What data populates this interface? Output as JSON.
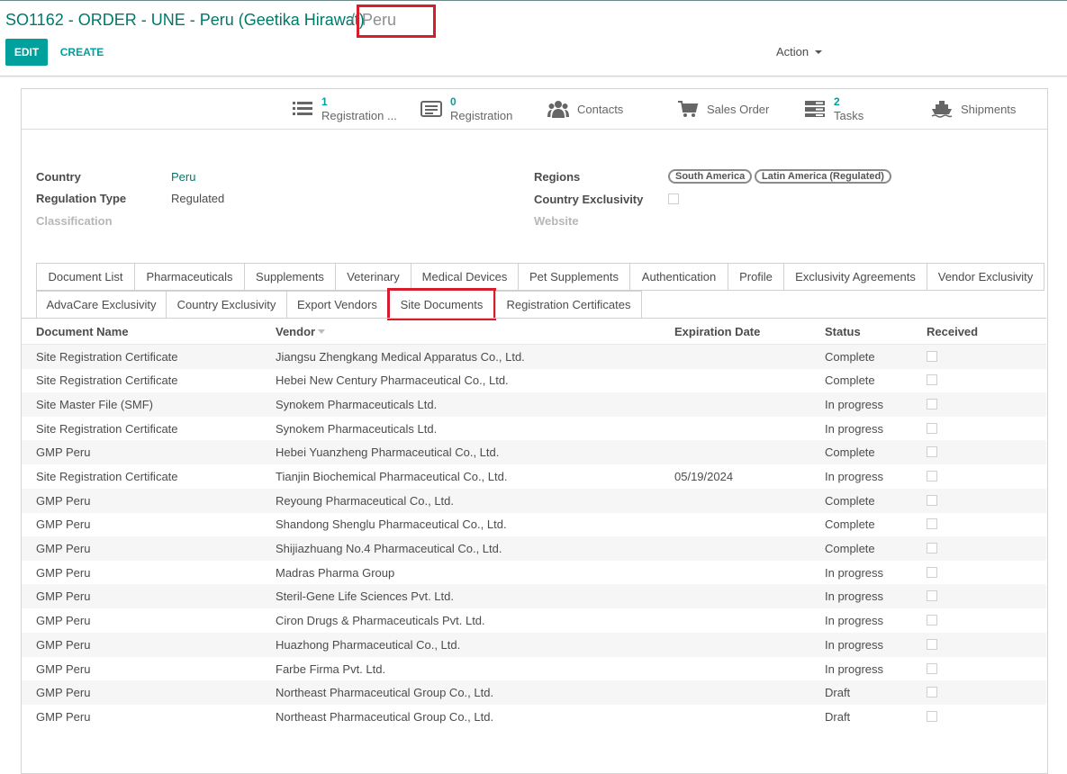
{
  "breadcrumb": {
    "parent": "SO1162 - ORDER - UNE - Peru (Geetika Hirawat)",
    "separator": "/",
    "current": "Peru"
  },
  "toolbar": {
    "edit_label": "EDIT",
    "create_label": "CREATE",
    "action_label": "Action"
  },
  "smart_buttons": {
    "registration_list": {
      "count": "1",
      "label": "Registration ..."
    },
    "registration": {
      "count": "0",
      "label": "Registration"
    },
    "contacts": {
      "label": "Contacts"
    },
    "sales_order": {
      "label": "Sales Order"
    },
    "tasks": {
      "count": "2",
      "label": "Tasks"
    },
    "shipments": {
      "label": "Shipments"
    }
  },
  "fields": {
    "country_label": "Country",
    "country_value": "Peru",
    "regulation_type_label": "Regulation Type",
    "regulation_type_value": "Regulated",
    "classification_label": "Classification",
    "regions_label": "Regions",
    "regions_tags": [
      "South America",
      "Latin America (Regulated)"
    ],
    "country_exclusivity_label": "Country Exclusivity",
    "country_exclusivity_checked": false,
    "website_label": "Website"
  },
  "tabs": [
    "Document List",
    "Pharmaceuticals",
    "Supplements",
    "Veterinary",
    "Medical Devices",
    "Pet Supplements",
    "Authentication",
    "Profile",
    "Exclusivity Agreements",
    "Vendor Exclusivity",
    "AdvaCare Exclusivity",
    "Country Exclusivity",
    "Export Vendors",
    "Site Documents",
    "Registration Certificates"
  ],
  "active_tab": "Site Documents",
  "table": {
    "headers": {
      "document_name": "Document Name",
      "vendor": "Vendor",
      "expiration_date": "Expiration Date",
      "status": "Status",
      "received": "Received"
    },
    "rows": [
      {
        "document_name": "Site Registration Certificate",
        "vendor": "Jiangsu Zhengkang Medical Apparatus Co., Ltd.",
        "expiration_date": "",
        "status": "Complete"
      },
      {
        "document_name": "Site Registration Certificate",
        "vendor": "Hebei New Century Pharmaceutical Co., Ltd.",
        "expiration_date": "",
        "status": "Complete"
      },
      {
        "document_name": "Site Master File (SMF)",
        "vendor": "Synokem Pharmaceuticals Ltd.",
        "expiration_date": "",
        "status": "In progress"
      },
      {
        "document_name": "Site Registration Certificate",
        "vendor": "Synokem Pharmaceuticals Ltd.",
        "expiration_date": "",
        "status": "In progress"
      },
      {
        "document_name": "GMP Peru",
        "vendor": "Hebei Yuanzheng Pharmaceutical Co., Ltd.",
        "expiration_date": "",
        "status": "Complete"
      },
      {
        "document_name": "Site Registration Certificate",
        "vendor": "Tianjin Biochemical Pharmaceutical Co., Ltd.",
        "expiration_date": "05/19/2024",
        "status": "In progress"
      },
      {
        "document_name": "GMP Peru",
        "vendor": "Reyoung Pharmaceutical Co., Ltd.",
        "expiration_date": "",
        "status": "Complete"
      },
      {
        "document_name": "GMP Peru",
        "vendor": "Shandong Shenglu Pharmaceutical Co., Ltd.",
        "expiration_date": "",
        "status": "Complete"
      },
      {
        "document_name": "GMP Peru",
        "vendor": "Shijiazhuang No.4 Pharmaceutical Co., Ltd.",
        "expiration_date": "",
        "status": "Complete"
      },
      {
        "document_name": "GMP Peru",
        "vendor": "Madras Pharma Group",
        "expiration_date": "",
        "status": "In progress"
      },
      {
        "document_name": "GMP Peru",
        "vendor": "Steril-Gene Life Sciences Pvt. Ltd.",
        "expiration_date": "",
        "status": "In progress"
      },
      {
        "document_name": "GMP Peru",
        "vendor": "Ciron Drugs & Pharmaceuticals Pvt. Ltd.",
        "expiration_date": "",
        "status": "In progress"
      },
      {
        "document_name": "GMP Peru",
        "vendor": "Huazhong Pharmaceutical Co., Ltd.",
        "expiration_date": "",
        "status": "In progress"
      },
      {
        "document_name": "GMP Peru",
        "vendor": "Farbe Firma Pvt. Ltd.",
        "expiration_date": "",
        "status": "In progress"
      },
      {
        "document_name": "GMP Peru",
        "vendor": "Northeast Pharmaceutical Group Co., Ltd.",
        "expiration_date": "",
        "status": "Draft"
      },
      {
        "document_name": "GMP Peru",
        "vendor": "Northeast Pharmaceutical Group Co., Ltd.",
        "expiration_date": "",
        "status": "Draft"
      }
    ]
  },
  "colors": {
    "accent": "#00a09d",
    "link": "#00796b",
    "highlight": "#d51d2c",
    "text": "#4c4c4c"
  }
}
